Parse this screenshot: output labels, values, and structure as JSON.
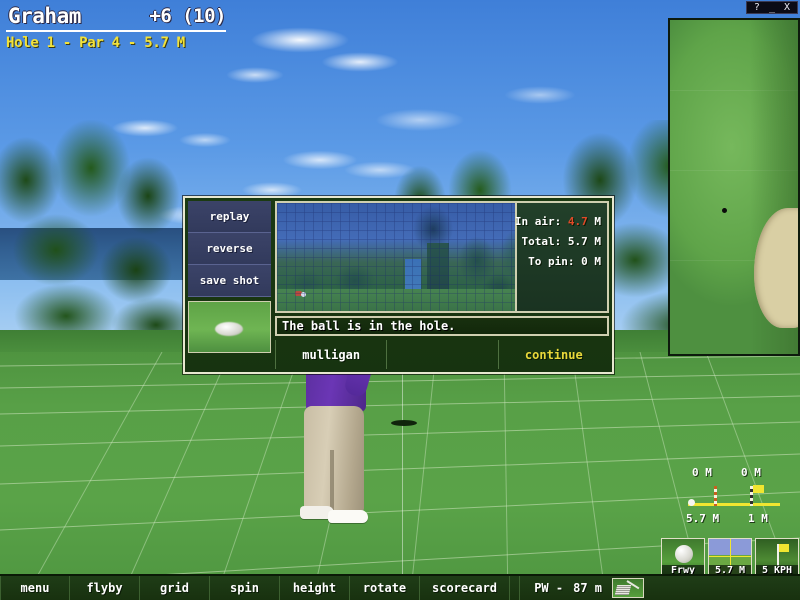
{
  "window": {
    "help_label": "?",
    "minimize_label": "_",
    "close_label": "X"
  },
  "hud": {
    "player_name": "Graham",
    "score": "+6 (10)",
    "hole_info": "Hole 1 - Par 4 - 5.7 M"
  },
  "dialog": {
    "side_buttons": [
      {
        "label": "replay"
      },
      {
        "label": "reverse"
      },
      {
        "label": "save shot"
      }
    ],
    "stats": [
      {
        "label": "In air:",
        "value": "4.7",
        "unit": "M",
        "highlight": true
      },
      {
        "label": "Total:",
        "value": "5.7",
        "unit": "M",
        "highlight": false
      },
      {
        "label": "To pin:",
        "value": "0",
        "unit": "M",
        "highlight": false
      }
    ],
    "message": "The ball is in the hole.",
    "buttons": [
      {
        "label": "mulligan",
        "accent": false
      },
      {
        "label": "",
        "accent": false
      },
      {
        "label": "continue",
        "accent": true
      }
    ]
  },
  "shot_widget": {
    "top_left_label": "0 M",
    "top_right_label": "0 M",
    "bottom_left_label": "5.7 M",
    "bottom_right_label": "1 M"
  },
  "tiles": [
    {
      "caption": "Frwy",
      "name": "lie"
    },
    {
      "caption": "5.7 M",
      "name": "distance"
    },
    {
      "caption": "5 KPH",
      "name": "wind"
    }
  ],
  "toolbar": {
    "buttons": [
      {
        "label": "menu"
      },
      {
        "label": "flyby"
      },
      {
        "label": "grid"
      },
      {
        "label": "spin"
      },
      {
        "label": "height"
      },
      {
        "label": "rotate"
      },
      {
        "label": "scorecard"
      }
    ],
    "club_label": "PW -",
    "club_distance": "87 m"
  },
  "colors": {
    "accent_yellow": "#e8d83a",
    "hole_text": "#f2e23a",
    "stat_highlight": "#e04a28",
    "sky": "#5b9ae6",
    "fairway": "#58a047",
    "dialog_border": "#e8e8d0",
    "side_button": "#3b4368"
  }
}
